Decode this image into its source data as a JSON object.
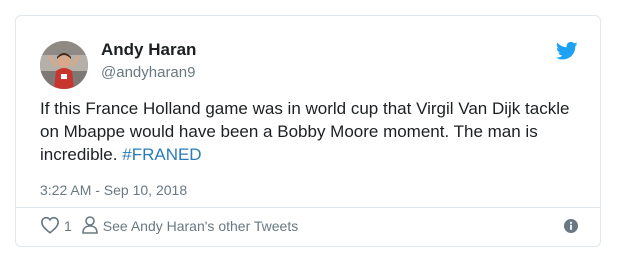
{
  "author": {
    "name": "Andy Haran",
    "handle": "@andyharan9"
  },
  "tweet": {
    "text_before_hashtag": "If this France Holland game was in world cup that Virgil Van Dijk tackle on Mbappe would have been a Bobby Moore moment. The man is incredible.",
    "hashtag": "#FRANED",
    "timestamp": "3:22 AM - Sep 10, 2018"
  },
  "actions": {
    "like_count": "1",
    "other_tweets_label": "See Andy Haran's other Tweets"
  },
  "icons": {
    "brand": "twitter-bird-icon",
    "like": "heart-icon",
    "profile": "person-icon",
    "info": "info-icon"
  },
  "colors": {
    "brand_blue": "#1da1f2",
    "hashtag_blue": "#2b7bb9",
    "text_primary": "#1c2022",
    "text_secondary": "#697882",
    "border": "#e1e8ed"
  }
}
